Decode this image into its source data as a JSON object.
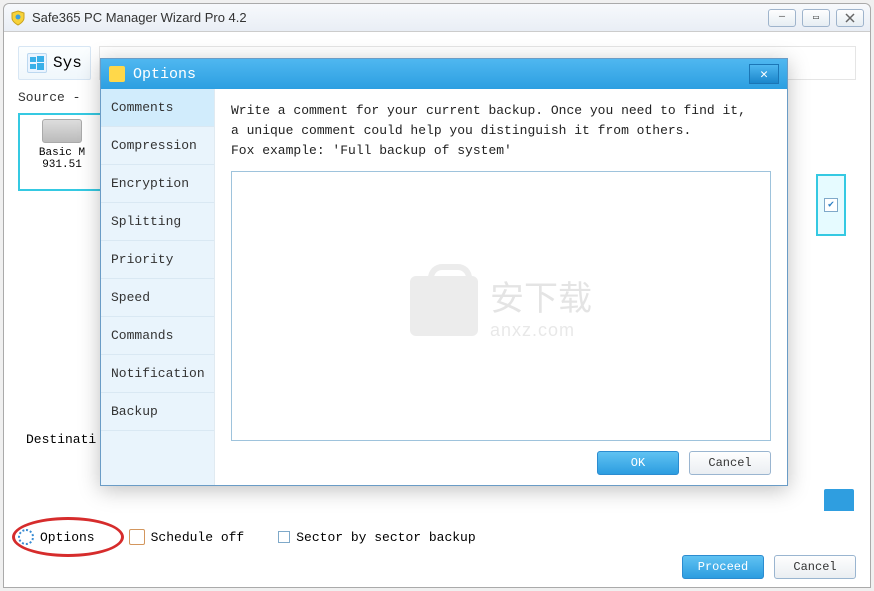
{
  "app": {
    "title": "Safe365 PC Manager Wizard Pro 4.2",
    "tab_label": "Sys"
  },
  "source": {
    "label": "Source -",
    "disk_name": "Basic M",
    "disk_size": "931.51"
  },
  "destination": {
    "label": "Destinati"
  },
  "bottom": {
    "options_label": "Options",
    "schedule_label": "Schedule off",
    "sector_label": "Sector by sector backup"
  },
  "footer": {
    "proceed": "Proceed",
    "cancel": "Cancel"
  },
  "dialog": {
    "title": "Options",
    "sidebar": [
      "Comments",
      "Compression",
      "Encryption",
      "Splitting",
      "Priority",
      "Speed",
      "Commands",
      "Notification",
      "Backup"
    ],
    "help_line1": "Write a comment for your current backup. Once you need to find it,",
    "help_line2": "a unique comment could help you distinguish it from others.",
    "help_line3": "Fox example: 'Full backup of system'",
    "ok_label": "OK",
    "cancel_label": "Cancel"
  },
  "watermark": {
    "cn": "安下载",
    "en": "anxz.com"
  }
}
